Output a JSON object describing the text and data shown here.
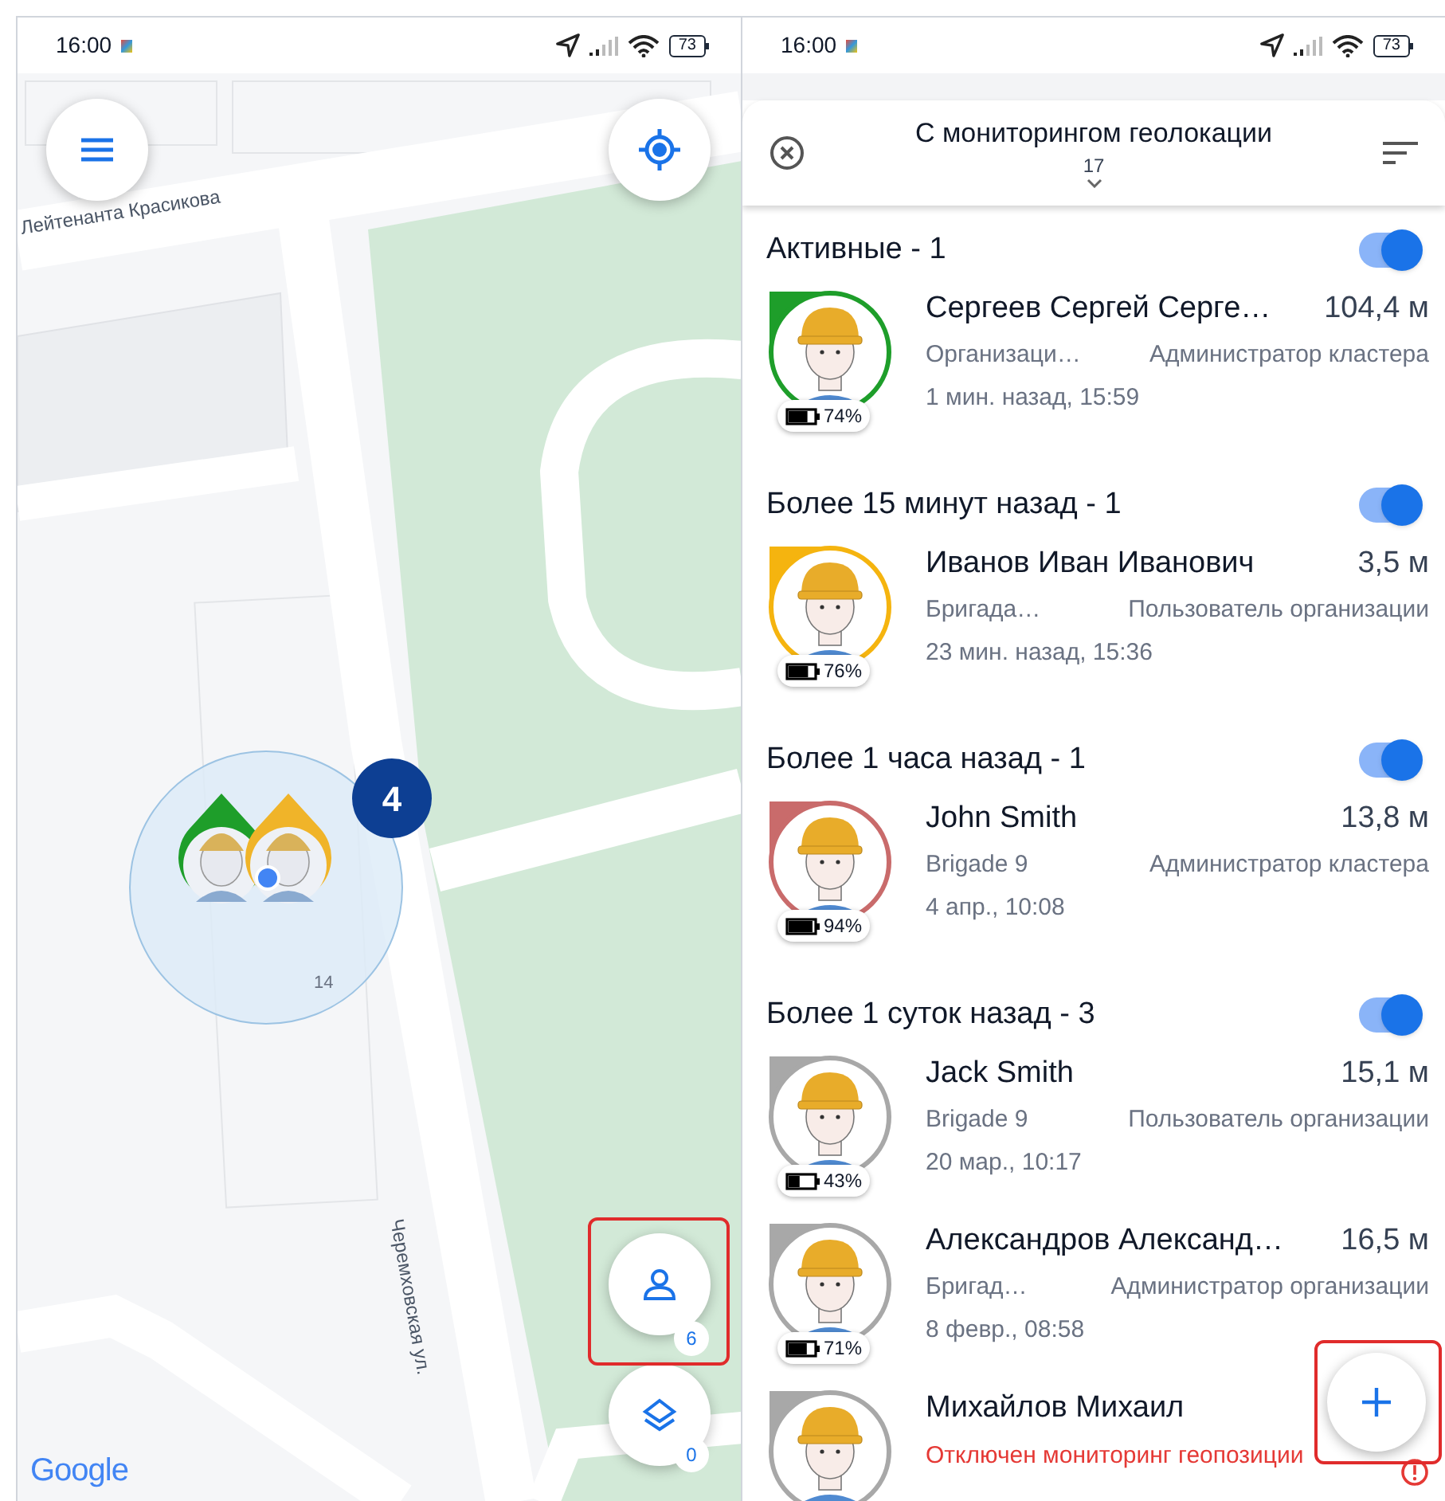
{
  "map_screen": {
    "status_bar": {
      "time": "16:00",
      "battery": "73"
    },
    "street_labels": [
      {
        "text": "Лейтенанта Красикова"
      },
      {
        "text": "Черемховская ул."
      }
    ],
    "cluster": {
      "count": "4",
      "radius_label": "14",
      "markers": [
        {
          "color": "#1e9e2a"
        },
        {
          "color": "#f0b429"
        }
      ]
    },
    "users_button": {
      "badge": "6"
    },
    "layers_button": {
      "badge": "0"
    },
    "logo": "Google"
  },
  "list_screen": {
    "status_bar": {
      "time": "16:00",
      "battery": "73"
    },
    "header": {
      "title": "С мониторингом геолокации",
      "count": "17"
    },
    "groups": [
      {
        "title": "Активные - 1",
        "on": true,
        "people": [
          {
            "kind": "normal",
            "name": "Сергеев Сергей Серге…",
            "distance": "104,4 м",
            "team": "Организаци…",
            "role": "Администратор кластера",
            "time": "1 мин. назад, 15:59",
            "battery": "74%",
            "color": "#1e9e2a"
          }
        ]
      },
      {
        "title": "Более 15 минут назад - 1",
        "on": true,
        "people": [
          {
            "kind": "normal",
            "name": "Иванов Иван Иванович",
            "distance": "3,5 м",
            "team": "Бригада…",
            "role": "Пользователь организации",
            "time": "23 мин. назад, 15:36",
            "battery": "76%",
            "color": "#f5b40f"
          }
        ]
      },
      {
        "title": "Более 1 часа назад - 1",
        "on": true,
        "people": [
          {
            "kind": "normal",
            "name": "John Smith",
            "distance": "13,8 м",
            "team": "Brigade 9",
            "role": "Администратор кластера",
            "time": "4 апр., 10:08",
            "battery": "94%",
            "color": "#c96b6b"
          }
        ]
      },
      {
        "title": "Более 1 суток назад - 3",
        "on": true,
        "people": [
          {
            "kind": "normal",
            "name": "Jack Smith",
            "distance": "15,1 м",
            "team": "Brigade 9",
            "role": "Пользователь организации",
            "time": "20 мар., 10:17",
            "battery": "43%",
            "color": "#a8a8a8"
          },
          {
            "kind": "normal",
            "name": "Александров Александ…",
            "distance": "16,5 м",
            "team": "Бригад…",
            "role": "Администратор организации",
            "time": "8 февр., 08:58",
            "battery": "71%",
            "color": "#a8a8a8"
          },
          {
            "kind": "warning",
            "name": "Михайлов Михаил",
            "warning": "Отключен мониторинг геопозиции",
            "color": "#a8a8a8"
          }
        ]
      }
    ]
  }
}
